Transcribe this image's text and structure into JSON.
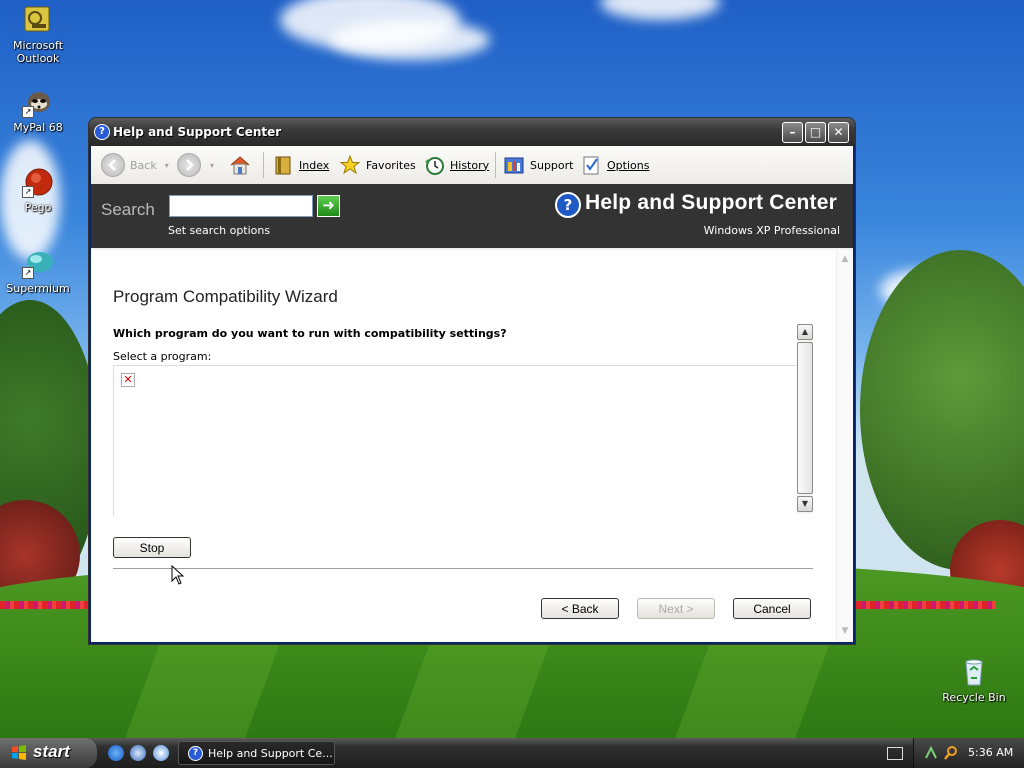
{
  "desktop": {
    "icons": [
      {
        "label": "Microsoft Outlook"
      },
      {
        "label": "MyPal 68"
      },
      {
        "label": "Pego"
      },
      {
        "label": "Supermium"
      },
      {
        "label": "Recycle Bin"
      }
    ]
  },
  "window": {
    "title": "Help and Support Center",
    "toolbar": {
      "back": "Back",
      "index": "Index",
      "favorites": "Favorites",
      "history": "History",
      "support": "Support",
      "options": "Options"
    },
    "header": {
      "search_label": "Search",
      "search_value": "",
      "search_options": "Set search options",
      "title": "Help and Support Center",
      "subtitle": "Windows XP Professional"
    },
    "wizard": {
      "title": "Program Compatibility Wizard",
      "question": "Which program do you want to run with compatibility settings?",
      "select_label": "Select a program:",
      "stop": "Stop",
      "back": "< Back",
      "next": "Next >",
      "cancel": "Cancel"
    }
  },
  "taskbar": {
    "start": "start",
    "task_label": "Help and Support Ce...",
    "clock": "5:36 AM"
  }
}
